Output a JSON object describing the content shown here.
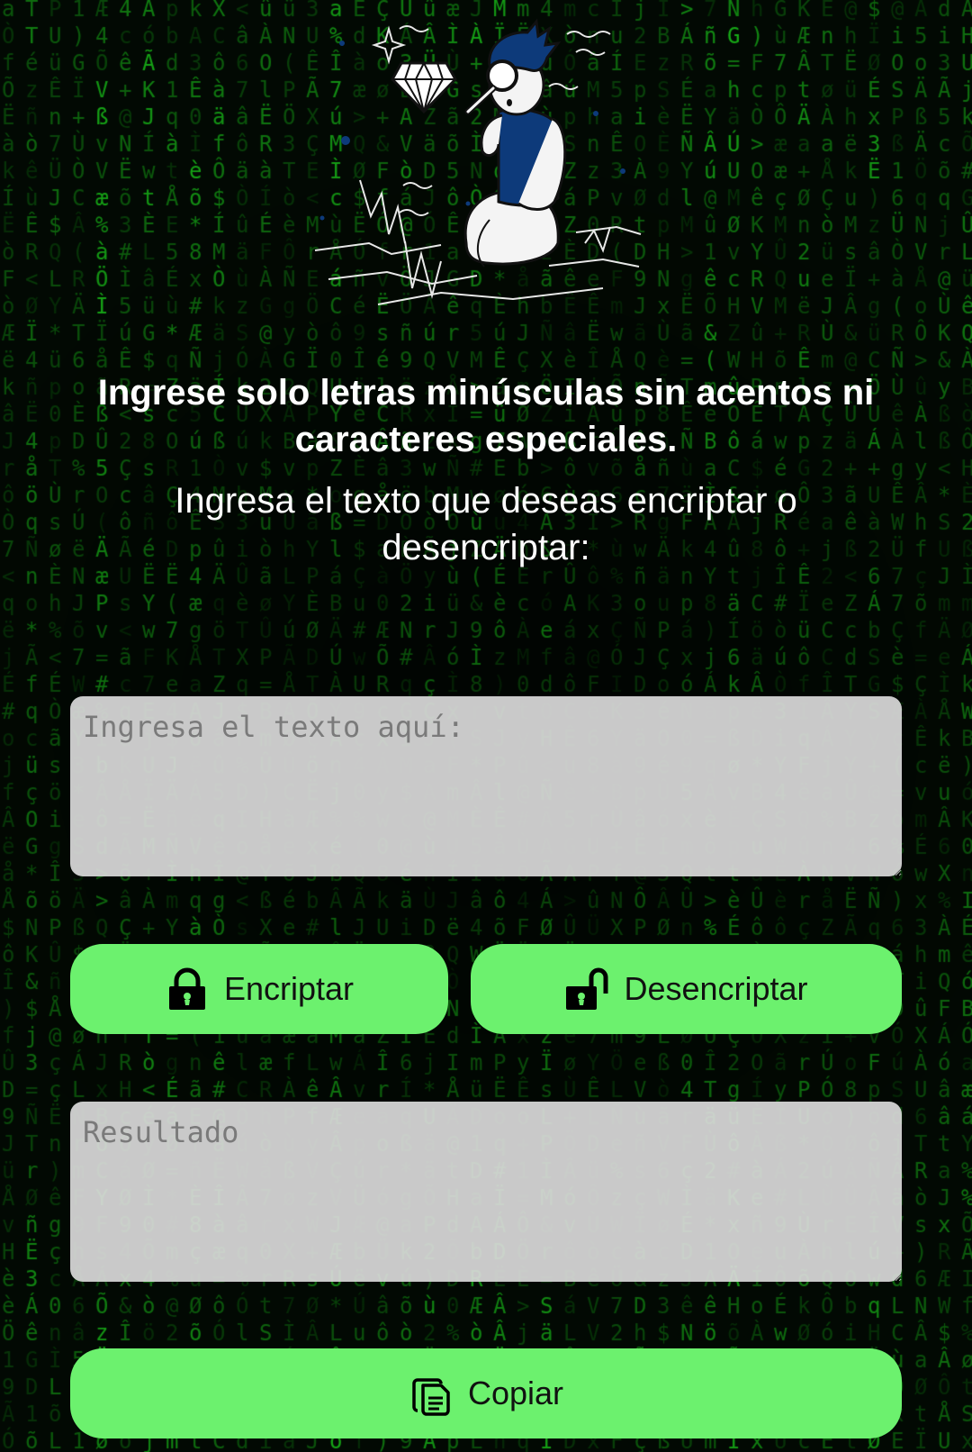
{
  "theme": {
    "accent": "#6cf16e",
    "rain_color": "#1fe81f",
    "background": "#020a03",
    "field_background": "#d8d8d8",
    "illustration_blue": "#0d3a7a"
  },
  "illustration": {
    "icon": "person-inspecting-diamond-icon"
  },
  "notice": "Ingrese solo letras minúsculas sin acentos ni caracteres especiales.",
  "instruction": "Ingresa el texto que deseas encriptar o desencriptar:",
  "input": {
    "value": "",
    "placeholder": "Ingresa el texto aquí:"
  },
  "actions": {
    "encrypt": {
      "label": "Encriptar",
      "icon": "lock-closed-icon"
    },
    "decrypt": {
      "label": "Desencriptar",
      "icon": "lock-open-icon"
    }
  },
  "output": {
    "value": "",
    "placeholder": "Resultado"
  },
  "copy": {
    "label": "Copiar",
    "icon": "copy-icon"
  }
}
